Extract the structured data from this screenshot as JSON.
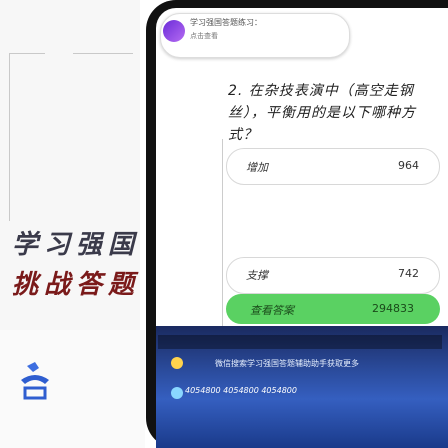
{
  "notification": {
    "line1": "学习强国答题练习：",
    "line2": "点击查看"
  },
  "question": {
    "text": "2. 在杂技表演中（高空走钢丝），平衡用的是以下哪种方式？"
  },
  "options": [
    {
      "label": "增加",
      "value": "964"
    },
    {
      "label": "",
      "value": ""
    },
    {
      "label": "支撑",
      "value": "742"
    }
  ],
  "answer": {
    "label": "查看答案",
    "value": "294833"
  },
  "left": {
    "row1": "学习强国",
    "row2": "挑战答题"
  },
  "dock": {
    "line1": "微信搜索学习强国答题辅助助手获取更多",
    "line2": "4054800 4054800 4054800"
  },
  "colors": {
    "answer_bg": "#5ad162",
    "dock_top": "#1a2a60",
    "dock_mid": "#355fc0"
  }
}
